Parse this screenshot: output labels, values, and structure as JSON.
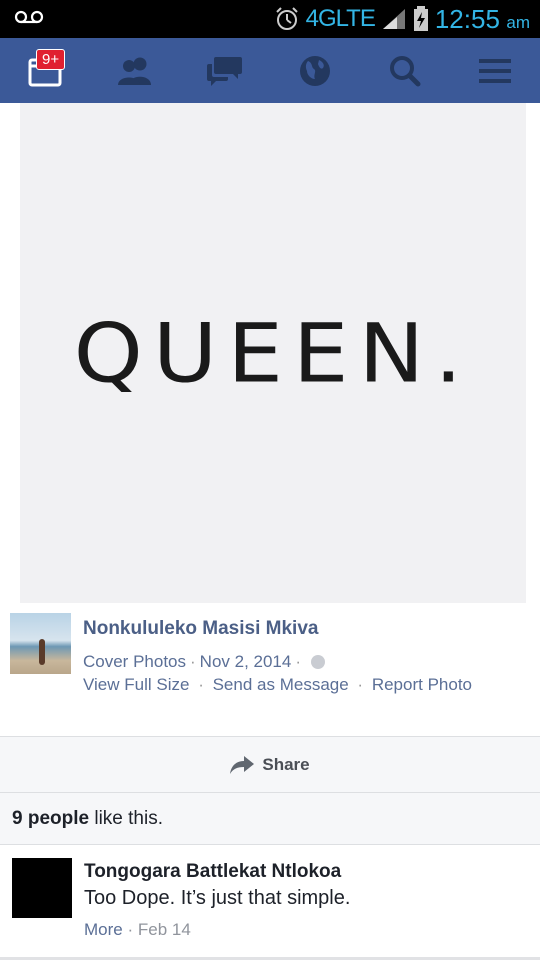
{
  "status_bar": {
    "network": "4GLTE",
    "time": "12:55",
    "ampm": "am",
    "icons": [
      "voicemail-icon",
      "alarm-icon",
      "signal-icon",
      "battery-charging-icon"
    ],
    "accent_color": "#33b5e5"
  },
  "nav": {
    "background": "#3b5998",
    "notification_badge": "9+",
    "items": [
      "notifications-icon",
      "friends-icon",
      "messages-icon",
      "globe-icon",
      "search-icon",
      "menu-icon"
    ]
  },
  "photo": {
    "text": "QUEEN."
  },
  "post": {
    "author": "Nonkululeko Masisi Mkiva",
    "album": "Cover Photos",
    "date": "Nov 2, 2014",
    "actions": {
      "view_full_size": "View Full Size",
      "send_as_message": "Send as Message",
      "report_photo": "Report Photo"
    }
  },
  "share": {
    "label": "Share"
  },
  "likes": {
    "count_text": "9 people",
    "suffix": "like this."
  },
  "comment": {
    "author": "Tongogara Battlekat Ntlokoa",
    "text": "Too Dope. It’s just that simple.",
    "more": "More",
    "date": "Feb 14"
  }
}
